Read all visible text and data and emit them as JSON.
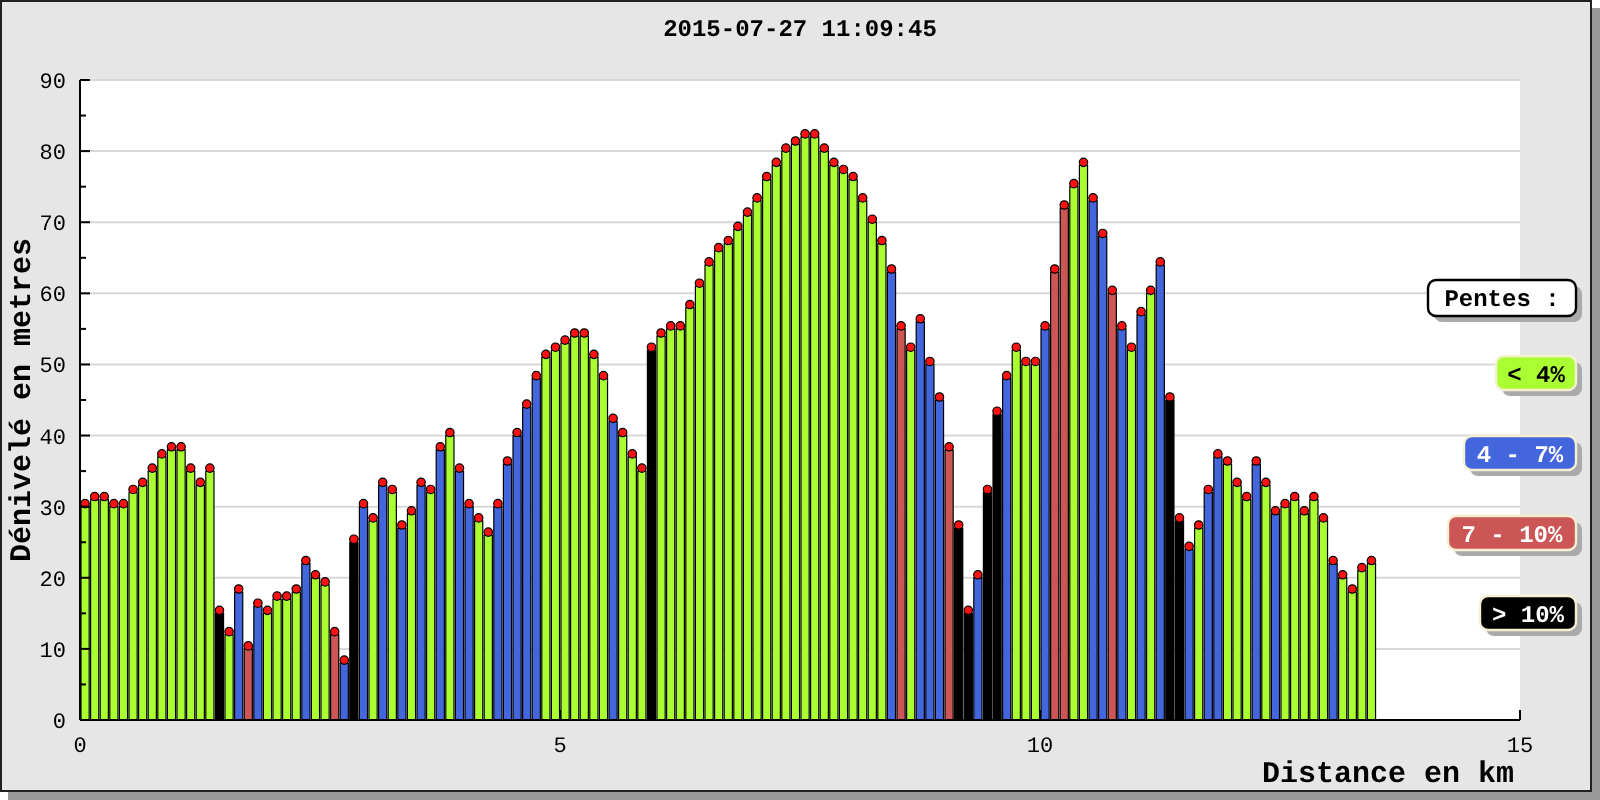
{
  "chart_panel": {
    "legend_title": "Pentes :",
    "chart_data": {
      "type": "bar",
      "stacked": true,
      "grid": true,
      "title": "2015-07-27 11:09:45",
      "xlabel": "Distance en km",
      "ylabel": "Dénivelé en metres",
      "xlim": [
        0,
        15
      ],
      "ylim": [
        0,
        90
      ],
      "xticks": [
        0,
        5,
        10,
        15
      ],
      "yticks": [
        0,
        10,
        20,
        30,
        40,
        50,
        60,
        70,
        80,
        90
      ],
      "x": [
        0,
        0.1,
        0.2,
        0.3,
        0.4,
        0.5,
        0.6,
        0.7,
        0.8,
        0.9,
        1,
        1.1,
        1.2,
        1.3,
        1.4,
        1.5,
        1.6,
        1.7,
        1.8,
        1.9,
        2,
        2.1,
        2.2,
        2.3,
        2.4,
        2.5,
        2.6,
        2.7,
        2.8,
        2.9,
        3,
        3.1,
        3.2,
        3.3,
        3.4,
        3.5,
        3.6,
        3.7,
        3.8,
        3.9,
        4,
        4.1,
        4.2,
        4.3,
        4.4,
        4.5,
        4.6,
        4.7,
        4.8,
        4.9,
        5,
        5.1,
        5.2,
        5.3,
        5.4,
        5.5,
        5.6,
        5.7,
        5.8,
        5.9,
        6,
        6.1,
        6.2,
        6.3,
        6.4,
        6.5,
        6.6,
        6.7,
        6.8,
        6.9,
        7,
        7.1,
        7.2,
        7.3,
        7.4,
        7.5,
        7.6,
        7.7,
        7.8,
        7.9,
        8,
        8.1,
        8.2,
        8.3,
        8.4,
        8.5,
        8.6,
        8.7,
        8.8,
        8.9,
        9,
        9.1,
        9.2,
        9.3,
        9.4,
        9.5,
        9.6,
        9.7,
        9.8,
        9.9,
        10,
        10.1,
        10.2,
        10.3,
        10.4,
        10.5,
        10.6,
        10.7,
        10.8,
        10.9,
        11,
        11.1,
        11.2,
        11.3,
        11.4,
        11.5,
        11.6,
        11.7,
        11.8,
        11.9,
        12,
        12.1,
        12.2,
        12.3,
        12.4,
        12.5,
        12.6,
        12.7,
        12.8,
        12.9,
        13,
        13.1,
        13.2,
        13.3,
        13.4
      ],
      "series": [
        {
          "name": "< 4%",
          "color": "#aaff33",
          "values": [
            30,
            31,
            31,
            30,
            30,
            32,
            33,
            35,
            37,
            38,
            38,
            35,
            33,
            35,
            null,
            12,
            null,
            null,
            null,
            15,
            17,
            17,
            18,
            null,
            20,
            19,
            null,
            null,
            null,
            null,
            28,
            null,
            32,
            null,
            29,
            null,
            32,
            null,
            40,
            null,
            null,
            28,
            26,
            null,
            null,
            null,
            null,
            null,
            51,
            52,
            53,
            54,
            54,
            51,
            48,
            null,
            40,
            37,
            35,
            null,
            54,
            55,
            55,
            58,
            61,
            64,
            66,
            67,
            69,
            71,
            73,
            76,
            78,
            80,
            81,
            82,
            82,
            80,
            78,
            77,
            76,
            73,
            70,
            67,
            null,
            null,
            52,
            null,
            null,
            null,
            null,
            null,
            null,
            null,
            null,
            null,
            null,
            52,
            50,
            50,
            null,
            null,
            null,
            75,
            78,
            null,
            null,
            null,
            null,
            52,
            null,
            60,
            null,
            null,
            null,
            null,
            27,
            null,
            null,
            36,
            33,
            31,
            null,
            33,
            null,
            30,
            31,
            29,
            31,
            28,
            null,
            20,
            18,
            21,
            22
          ]
        },
        {
          "name": "4 - 7%",
          "color": "#4466dd",
          "values": [
            null,
            null,
            null,
            null,
            null,
            null,
            null,
            null,
            null,
            null,
            null,
            null,
            null,
            null,
            null,
            null,
            18,
            null,
            16,
            null,
            null,
            null,
            null,
            22,
            null,
            null,
            null,
            8,
            null,
            30,
            null,
            33,
            null,
            27,
            null,
            33,
            null,
            38,
            null,
            35,
            30,
            null,
            null,
            30,
            36,
            40,
            44,
            48,
            null,
            null,
            null,
            null,
            null,
            null,
            null,
            42,
            null,
            null,
            null,
            null,
            null,
            null,
            null,
            null,
            null,
            null,
            null,
            null,
            null,
            null,
            null,
            null,
            null,
            null,
            null,
            null,
            null,
            null,
            null,
            null,
            null,
            null,
            null,
            null,
            63,
            null,
            null,
            56,
            50,
            45,
            null,
            null,
            null,
            20,
            null,
            null,
            48,
            null,
            null,
            null,
            55,
            null,
            null,
            null,
            null,
            73,
            68,
            null,
            55,
            null,
            57,
            null,
            64,
            null,
            null,
            24,
            null,
            32,
            37,
            null,
            null,
            null,
            36,
            null,
            29,
            null,
            null,
            null,
            null,
            null,
            22,
            null,
            null,
            null,
            null
          ]
        },
        {
          "name": "7 - 10%",
          "color": "#cc5555",
          "values": [
            null,
            null,
            null,
            null,
            null,
            null,
            null,
            null,
            null,
            null,
            null,
            null,
            null,
            null,
            null,
            null,
            null,
            10,
            null,
            null,
            null,
            null,
            null,
            null,
            null,
            null,
            12,
            null,
            null,
            null,
            null,
            null,
            null,
            null,
            null,
            null,
            null,
            null,
            null,
            null,
            null,
            null,
            null,
            null,
            null,
            null,
            null,
            null,
            null,
            null,
            null,
            null,
            null,
            null,
            null,
            null,
            null,
            null,
            null,
            null,
            null,
            null,
            null,
            null,
            null,
            null,
            null,
            null,
            null,
            null,
            null,
            null,
            null,
            null,
            null,
            null,
            null,
            null,
            null,
            null,
            null,
            null,
            null,
            null,
            null,
            55,
            null,
            null,
            null,
            null,
            38,
            null,
            null,
            null,
            null,
            null,
            null,
            null,
            null,
            null,
            null,
            63,
            72,
            null,
            null,
            null,
            null,
            60,
            null,
            null,
            null,
            null,
            null,
            null,
            null,
            null,
            null,
            null,
            null,
            null,
            null,
            null,
            null,
            null,
            null,
            null,
            null,
            null,
            null,
            null,
            null,
            null,
            null,
            null,
            null
          ]
        },
        {
          "name": "> 10%",
          "color": "#000000",
          "values": [
            null,
            null,
            null,
            null,
            null,
            null,
            null,
            null,
            null,
            null,
            null,
            null,
            null,
            null,
            15,
            null,
            null,
            null,
            null,
            null,
            null,
            null,
            null,
            null,
            null,
            null,
            null,
            null,
            25,
            null,
            null,
            null,
            null,
            null,
            null,
            null,
            null,
            null,
            null,
            null,
            null,
            null,
            null,
            null,
            null,
            null,
            null,
            null,
            null,
            null,
            null,
            null,
            null,
            null,
            null,
            null,
            null,
            null,
            null,
            52,
            null,
            null,
            null,
            null,
            null,
            null,
            null,
            null,
            null,
            null,
            null,
            null,
            null,
            null,
            null,
            null,
            null,
            null,
            null,
            null,
            null,
            null,
            null,
            null,
            null,
            null,
            null,
            null,
            null,
            null,
            null,
            27,
            15,
            null,
            32,
            43,
            null,
            null,
            null,
            null,
            null,
            null,
            null,
            null,
            null,
            null,
            null,
            null,
            null,
            null,
            null,
            null,
            null,
            45,
            28,
            null,
            null,
            null,
            null,
            null,
            null,
            null,
            null,
            null,
            null,
            null,
            null,
            null,
            null,
            null,
            null,
            null,
            null,
            null,
            null
          ]
        }
      ]
    }
  }
}
